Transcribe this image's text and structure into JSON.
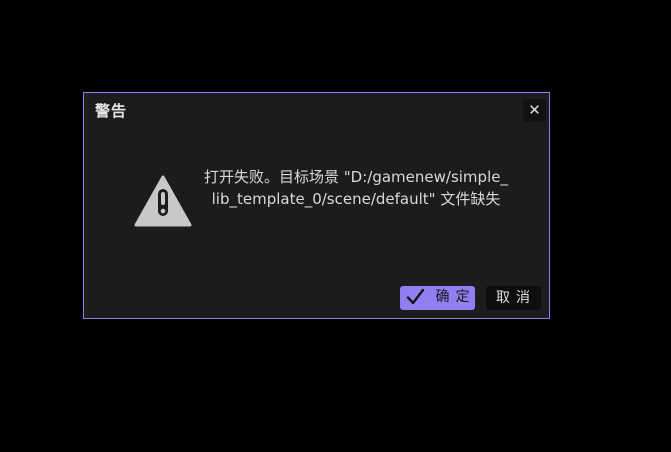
{
  "dialog": {
    "title": "警告",
    "close_label": "✕",
    "message": "打开失败。目标场景 \"D:/gamenew/simple_lib_template_0/scene/default\" 文件缺失",
    "ok_label": "确定",
    "cancel_label": "取消"
  },
  "icons": {
    "close": "close-icon",
    "warning": "warning-icon",
    "check": "check-icon"
  },
  "colors": {
    "background": "#000000",
    "dialog_bg": "#1c1c1f",
    "dialog_border": "#8c7fe8",
    "accent": "#8f7ff0",
    "warning_icon": "#c8c8c8"
  }
}
